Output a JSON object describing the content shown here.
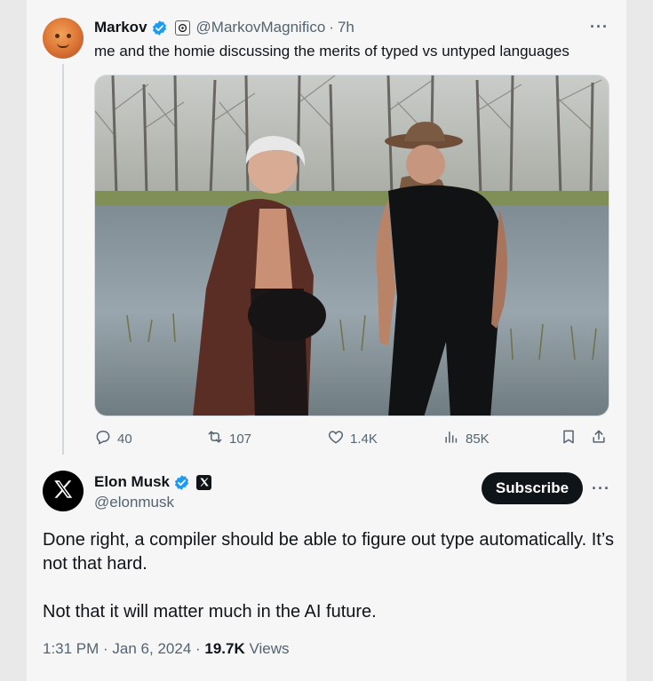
{
  "colors": {
    "accent": "#1d9bf0",
    "text": "#0f1419",
    "muted": "#536471",
    "card": "#f6f6f7"
  },
  "quoted_tweet": {
    "display_name": "Markov",
    "handle": "@MarkovMagnifico",
    "separator": "·",
    "time": "7h",
    "text": "me and the homie discussing the merits of typed vs untyped languages",
    "more": "···",
    "stats": {
      "replies": "40",
      "reposts": "107",
      "likes": "1.4K",
      "views": "85K"
    }
  },
  "tweet": {
    "display_name": "Elon Musk",
    "handle": "@elonmusk",
    "subscribe_label": "Subscribe",
    "more": "···",
    "paragraph_1": "Done right, a compiler should be able to figure out type automatically. It’s not that hard.",
    "paragraph_2": "Not that it will matter much in the AI future.",
    "time": "1:31 PM",
    "date_sep": " · ",
    "date": "Jan 6, 2024",
    "views_sep": " · ",
    "views_count": "19.7K",
    "views_label": "Views"
  },
  "icons": [
    "verified-icon",
    "affiliate-badge-icon",
    "reply-icon",
    "repost-icon",
    "like-icon",
    "views-icon",
    "bookmark-icon",
    "share-icon",
    "x-logo-icon",
    "more-icon"
  ]
}
